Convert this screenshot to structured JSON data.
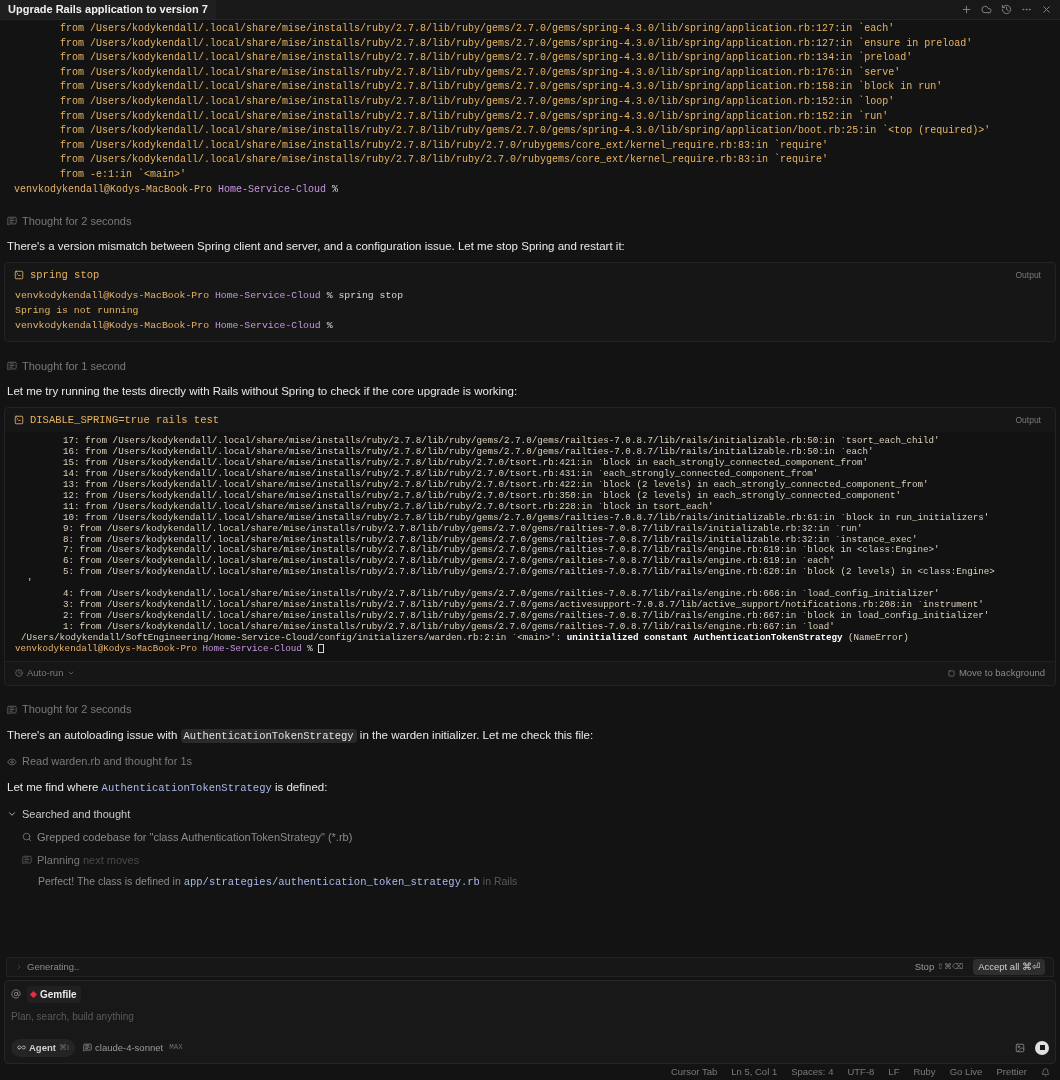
{
  "window": {
    "title": "Upgrade Rails application to version 7"
  },
  "messages": [
    {
      "kind": "trace",
      "lines": [
        {
          "kind": "trace",
          "text": "from /Users/kodykendall/.local/share/mise/installs/ruby/2.7.8/lib/ruby/gems/2.7.0/gems/spring-4.3.0/lib/spring/application.rb:127:in `each'"
        },
        {
          "kind": "trace",
          "text": "from /Users/kodykendall/.local/share/mise/installs/ruby/2.7.8/lib/ruby/gems/2.7.0/gems/spring-4.3.0/lib/spring/application.rb:127:in `ensure in preload'"
        },
        {
          "kind": "trace",
          "text": "from /Users/kodykendall/.local/share/mise/installs/ruby/2.7.8/lib/ruby/gems/2.7.0/gems/spring-4.3.0/lib/spring/application.rb:134:in `preload'"
        },
        {
          "kind": "trace",
          "text": "from /Users/kodykendall/.local/share/mise/installs/ruby/2.7.8/lib/ruby/gems/2.7.0/gems/spring-4.3.0/lib/spring/application.rb:176:in `serve'"
        },
        {
          "kind": "trace",
          "text": "from /Users/kodykendall/.local/share/mise/installs/ruby/2.7.8/lib/ruby/gems/2.7.0/gems/spring-4.3.0/lib/spring/application.rb:158:in `block in run'"
        },
        {
          "kind": "trace",
          "text": "from /Users/kodykendall/.local/share/mise/installs/ruby/2.7.8/lib/ruby/gems/2.7.0/gems/spring-4.3.0/lib/spring/application.rb:152:in `loop'"
        },
        {
          "kind": "trace",
          "text": "from /Users/kodykendall/.local/share/mise/installs/ruby/2.7.8/lib/ruby/gems/2.7.0/gems/spring-4.3.0/lib/spring/application.rb:152:in `run'"
        },
        {
          "kind": "trace",
          "text": "from /Users/kodykendall/.local/share/mise/installs/ruby/2.7.8/lib/ruby/gems/2.7.0/gems/spring-4.3.0/lib/spring/application/boot.rb:25:in `<top (required)>'"
        },
        {
          "kind": "trace",
          "text": "from /Users/kodykendall/.local/share/mise/installs/ruby/2.7.8/lib/ruby/2.7.0/rubygems/core_ext/kernel_require.rb:83:in `require'"
        },
        {
          "kind": "trace",
          "text": "from /Users/kodykendall/.local/share/mise/installs/ruby/2.7.8/lib/ruby/2.7.0/rubygems/core_ext/kernel_require.rb:83:in `require'"
        },
        {
          "kind": "trace",
          "text": "from -e:1:in `<main>'"
        },
        {
          "kind": "prompt",
          "user": "venvkodykendall@Kodys-MacBook-Pro",
          "dir": "Home-Service-Cloud",
          "symbol": "%"
        }
      ]
    },
    {
      "kind": "thought",
      "text": "Thought for 2 seconds"
    },
    {
      "kind": "paragraph",
      "parts": [
        {
          "kind": "text",
          "text": "There's a version mismatch between Spring client and server, and a configuration issue. Let me stop Spring and restart it:"
        }
      ]
    },
    {
      "kind": "terminal",
      "command": "spring stop",
      "output_label": "Output",
      "lines": [
        {
          "kind": "prompt",
          "user": "venvkodykendall@Kodys-MacBook-Pro",
          "dir": "Home-Service-Cloud",
          "symbol": "%",
          "command": "spring stop"
        },
        {
          "kind": "output",
          "text": "Spring is not running"
        },
        {
          "kind": "prompt",
          "user": "venvkodykendall@Kodys-MacBook-Pro",
          "dir": "Home-Service-Cloud",
          "symbol": "%"
        }
      ]
    },
    {
      "kind": "thought",
      "text": "Thought for 1 second"
    },
    {
      "kind": "paragraph",
      "parts": [
        {
          "kind": "text",
          "text": "Let me try running the tests directly with Rails without Spring to check if the core upgrade is working:"
        }
      ]
    },
    {
      "kind": "terminal",
      "command": "DISABLE_SPRING=true rails test",
      "output_label": "Output",
      "auto_run": "Auto-run",
      "background": "Move to background",
      "lines": [
        {
          "kind": "numbered",
          "text": "17: from /Users/kodykendall/.local/share/mise/installs/ruby/2.7.8/lib/ruby/gems/2.7.0/gems/railties-7.0.8.7/lib/rails/initializable.rb:50:in `tsort_each_child'"
        },
        {
          "kind": "numbered",
          "text": "16: from /Users/kodykendall/.local/share/mise/installs/ruby/2.7.8/lib/ruby/gems/2.7.0/gems/railties-7.0.8.7/lib/rails/initializable.rb:50:in `each'"
        },
        {
          "kind": "numbered",
          "text": "15: from /Users/kodykendall/.local/share/mise/installs/ruby/2.7.8/lib/ruby/2.7.0/tsort.rb:421:in `block in each_strongly_connected_component_from'"
        },
        {
          "kind": "numbered",
          "text": "14: from /Users/kodykendall/.local/share/mise/installs/ruby/2.7.8/lib/ruby/2.7.0/tsort.rb:431:in `each_strongly_connected_component_from'"
        },
        {
          "kind": "numbered",
          "text": "13: from /Users/kodykendall/.local/share/mise/installs/ruby/2.7.8/lib/ruby/2.7.0/tsort.rb:422:in `block (2 levels) in each_strongly_connected_component_from'"
        },
        {
          "kind": "numbered",
          "text": "12: from /Users/kodykendall/.local/share/mise/installs/ruby/2.7.8/lib/ruby/2.7.0/tsort.rb:350:in `block (2 levels) in each_strongly_connected_component'"
        },
        {
          "kind": "numbered",
          "text": "11: from /Users/kodykendall/.local/share/mise/installs/ruby/2.7.8/lib/ruby/2.7.0/tsort.rb:228:in `block in tsort_each'"
        },
        {
          "kind": "numbered",
          "text": "10: from /Users/kodykendall/.local/share/mise/installs/ruby/2.7.8/lib/ruby/gems/2.7.0/gems/railties-7.0.8.7/lib/rails/initializable.rb:61:in `block in run_initializers'"
        },
        {
          "kind": "numbered",
          "text": "9: from /Users/kodykendall/.local/share/mise/installs/ruby/2.7.8/lib/ruby/gems/2.7.0/gems/railties-7.0.8.7/lib/rails/initializable.rb:32:in `run'"
        },
        {
          "kind": "numbered",
          "text": "8: from /Users/kodykendall/.local/share/mise/installs/ruby/2.7.8/lib/ruby/gems/2.7.0/gems/railties-7.0.8.7/lib/rails/initializable.rb:32:in `instance_exec'"
        },
        {
          "kind": "numbered",
          "text": "7: from /Users/kodykendall/.local/share/mise/installs/ruby/2.7.8/lib/ruby/gems/2.7.0/gems/railties-7.0.8.7/lib/rails/engine.rb:619:in `block in <class:Engine>'"
        },
        {
          "kind": "numbered",
          "text": "6: from /Users/kodykendall/.local/share/mise/installs/ruby/2.7.8/lib/ruby/gems/2.7.0/gems/railties-7.0.8.7/lib/rails/engine.rb:619:in `each'"
        },
        {
          "kind": "numbered",
          "text": "5: from /Users/kodykendall/.local/share/mise/installs/ruby/2.7.8/lib/ruby/gems/2.7.0/gems/railties-7.0.8.7/lib/rails/engine.rb:620:in `block (2 levels) in <class:Engine>"
        },
        {
          "kind": "wrap",
          "text": "'"
        },
        {
          "kind": "numbered",
          "text": "4: from /Users/kodykendall/.local/share/mise/installs/ruby/2.7.8/lib/ruby/gems/2.7.0/gems/railties-7.0.8.7/lib/rails/engine.rb:666:in `load_config_initializer'"
        },
        {
          "kind": "numbered",
          "text": "3: from /Users/kodykendall/.local/share/mise/installs/ruby/2.7.8/lib/ruby/gems/2.7.0/gems/activesupport-7.0.8.7/lib/active_support/notifications.rb:208:in `instrument'"
        },
        {
          "kind": "numbered",
          "text": "2: from /Users/kodykendall/.local/share/mise/installs/ruby/2.7.8/lib/ruby/gems/2.7.0/gems/railties-7.0.8.7/lib/rails/engine.rb:667:in `block in load_config_initializer'"
        },
        {
          "kind": "numbered",
          "text": "1: from /Users/kodykendall/.local/share/mise/installs/ruby/2.7.8/lib/ruby/gems/2.7.0/gems/railties-7.0.8.7/lib/rails/engine.rb:667:in `load'"
        },
        {
          "kind": "error",
          "text": "/Users/kodykendall/SoftEngineering/Home-Service-Cloud/config/initializers/warden.rb:2:in `<main>': **uninitialized constant AuthenticationTokenStrategy** (NameError)"
        },
        {
          "kind": "prompt",
          "user": "venvkodykendall@Kodys-MacBook-Pro",
          "dir": "Home-Service-Cloud",
          "symbol": "%",
          "cursor": true
        }
      ]
    },
    {
      "kind": "thought",
      "text": "Thought for 2 seconds"
    },
    {
      "kind": "paragraph",
      "parts": [
        {
          "kind": "text",
          "text": "There's an autoloading issue with "
        },
        {
          "kind": "chip",
          "text": "AuthenticationTokenStrategy"
        },
        {
          "kind": "text",
          "text": " in the warden initializer. Let me check this file:"
        }
      ]
    },
    {
      "kind": "activity",
      "text": "Read warden.rb and thought for 1s"
    },
    {
      "kind": "paragraph",
      "parts": [
        {
          "kind": "text",
          "text": "Let me find where "
        },
        {
          "kind": "code",
          "text": "AuthenticationTokenStrategy"
        },
        {
          "kind": "text",
          "text": " is defined:"
        }
      ]
    },
    {
      "kind": "group",
      "label": "Searched and thought",
      "expanded": true,
      "children": [
        {
          "kind": "search",
          "text": "Grepped codebase for \"class AuthenticationTokenStrategy\" (*.rb)"
        },
        {
          "kind": "planning",
          "text": "Planning",
          "suffix": "next moves"
        },
        {
          "kind": "result",
          "parts": [
            {
              "kind": "text",
              "text": "Perfect! The class is defined in "
            },
            {
              "kind": "code",
              "text": "app/strategies/authentication_token_strategy.rb"
            },
            {
              "kind": "faint",
              "text": " in Rails"
            }
          ]
        }
      ]
    }
  ],
  "generating": {
    "label": "Generating..",
    "stop": "Stop",
    "stop_keys": "⇧⌘⌫",
    "accept": "Accept all ⌘⏎"
  },
  "composer": {
    "context": "Gemfile",
    "placeholder": "Plan, search, build anything",
    "mode": "Agent",
    "mode_keys": "⌘I",
    "model": "claude-4-sonnet",
    "model_badge": "MAX"
  },
  "status_bar": [
    "Cursor Tab",
    "Ln 5, Col 1",
    "Spaces: 4",
    "UTF-8",
    "LF",
    "Ruby",
    "Go Live",
    "Prettier"
  ]
}
